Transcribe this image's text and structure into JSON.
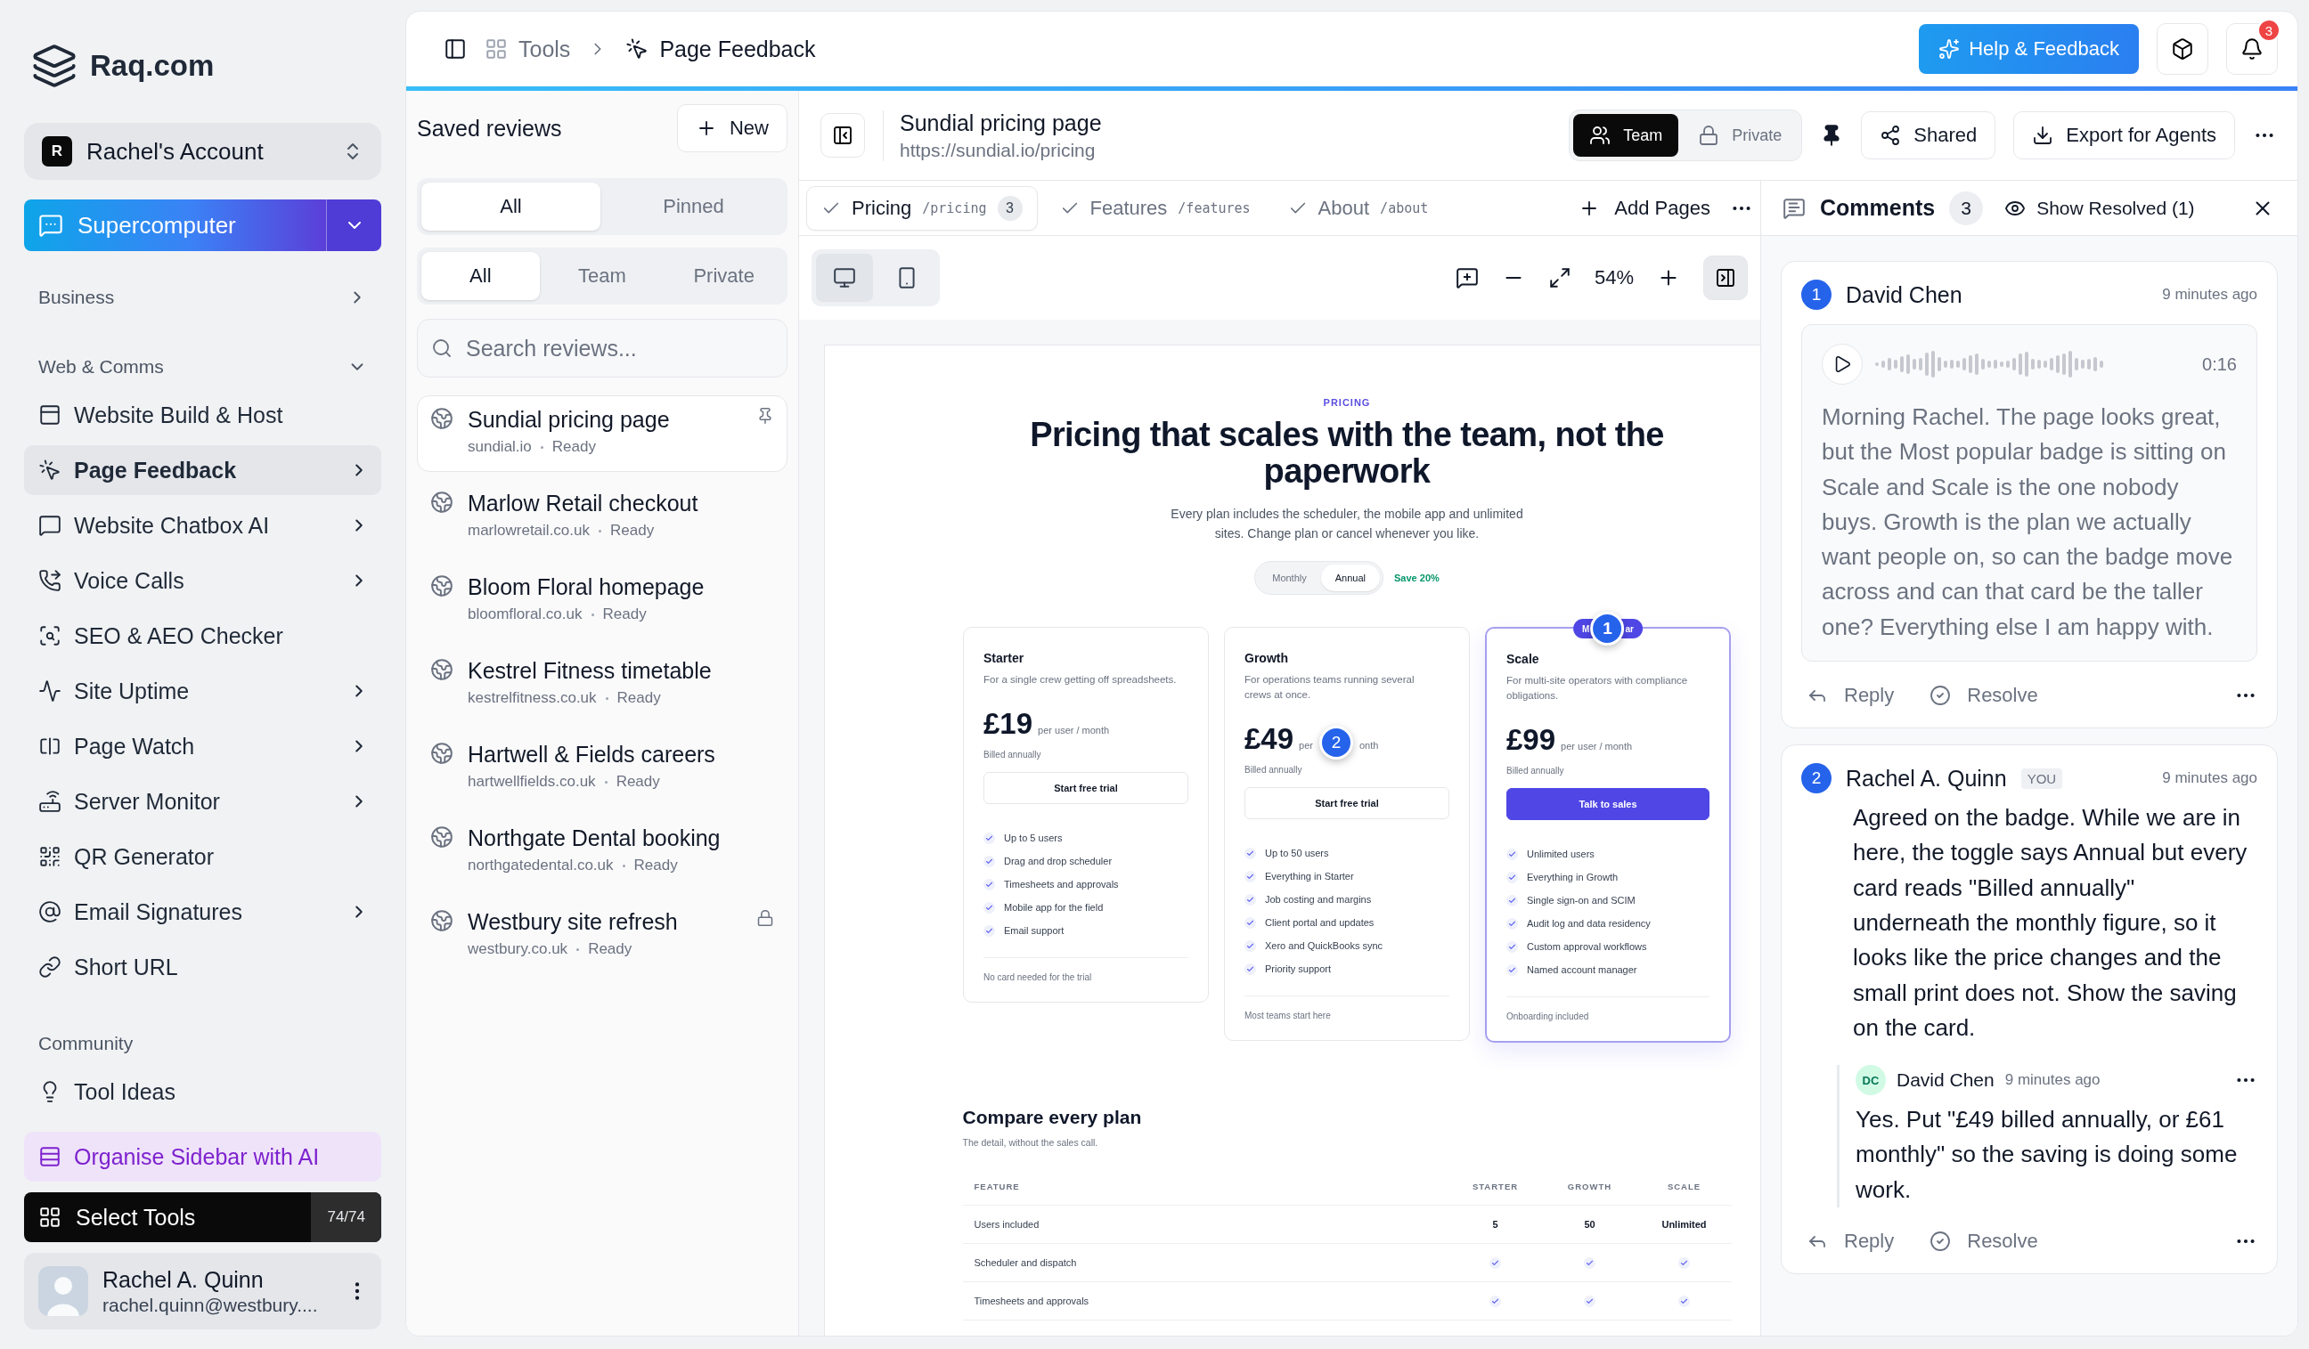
{
  "sidebar": {
    "brand": "Raq.com",
    "account": {
      "initial": "R",
      "name": "Rachel's Account"
    },
    "assistant": "Supercomputer",
    "sections": [
      {
        "title": "Business",
        "expanded": false
      },
      {
        "title": "Web & Comms",
        "expanded": true,
        "items": [
          {
            "label": "Website Build & Host",
            "selected": false,
            "submenu": false
          },
          {
            "label": "Page Feedback",
            "selected": true,
            "submenu": true
          },
          {
            "label": "Website Chatbox AI",
            "selected": false,
            "submenu": true
          },
          {
            "label": "Voice Calls",
            "selected": false,
            "submenu": true
          },
          {
            "label": "SEO & AEO Checker",
            "selected": false,
            "submenu": false
          },
          {
            "label": "Site Uptime",
            "selected": false,
            "submenu": true
          },
          {
            "label": "Page Watch",
            "selected": false,
            "submenu": true
          },
          {
            "label": "Server Monitor",
            "selected": false,
            "submenu": true
          },
          {
            "label": "QR Generator",
            "selected": false,
            "submenu": false
          },
          {
            "label": "Email Signatures",
            "selected": false,
            "submenu": true
          },
          {
            "label": "Short URL",
            "selected": false,
            "submenu": false
          }
        ]
      },
      {
        "title": "Community",
        "items": [
          {
            "label": "Tool Ideas",
            "selected": false,
            "submenu": false
          }
        ]
      }
    ],
    "organise": "Organise Sidebar with AI",
    "select_tools": {
      "label": "Select Tools",
      "count": "74/74"
    },
    "user": {
      "name": "Rachel A. Quinn",
      "email": "rachel.quinn@westbury...."
    }
  },
  "header": {
    "breadcrumb": [
      "Tools",
      "Page Feedback"
    ],
    "help_button": "Help & Feedback",
    "notification_count": "3"
  },
  "reviews": {
    "title": "Saved reviews",
    "new_button": "New",
    "scope_filter": [
      {
        "label": "All",
        "selected": true
      },
      {
        "label": "Pinned",
        "selected": false
      }
    ],
    "visibility_filter": [
      {
        "label": "All",
        "selected": true
      },
      {
        "label": "Team",
        "selected": false
      },
      {
        "label": "Private",
        "selected": false
      }
    ],
    "search_placeholder": "Search reviews...",
    "items": [
      {
        "title": "Sundial pricing page",
        "domain": "sundial.io",
        "status": "Ready",
        "selected": true,
        "pinned": true,
        "private": false
      },
      {
        "title": "Marlow Retail checkout",
        "domain": "marlowretail.co.uk",
        "status": "Ready",
        "selected": false,
        "pinned": false,
        "private": false
      },
      {
        "title": "Bloom Floral homepage",
        "domain": "bloomfloral.co.uk",
        "status": "Ready",
        "selected": false,
        "pinned": false,
        "private": false
      },
      {
        "title": "Kestrel Fitness timetable",
        "domain": "kestrelfitness.co.uk",
        "status": "Ready",
        "selected": false,
        "pinned": false,
        "private": false
      },
      {
        "title": "Hartwell & Fields careers",
        "domain": "hartwellfields.co.uk",
        "status": "Ready",
        "selected": false,
        "pinned": false,
        "private": false
      },
      {
        "title": "Northgate Dental booking",
        "domain": "northgatedental.co.uk",
        "status": "Ready",
        "selected": false,
        "pinned": false,
        "private": false
      },
      {
        "title": "Westbury site refresh",
        "domain": "westbury.co.uk",
        "status": "Ready",
        "selected": false,
        "pinned": false,
        "private": true
      }
    ]
  },
  "review": {
    "title": "Sundial pricing page",
    "url": "https://sundial.io/pricing",
    "visibility": [
      {
        "label": "Team",
        "selected": true
      },
      {
        "label": "Private",
        "selected": false
      }
    ],
    "pinned": true,
    "shared_button": "Shared",
    "export_button": "Export for Agents"
  },
  "pages": [
    {
      "label": "Pricing",
      "path": "/pricing",
      "count": "3",
      "selected": true
    },
    {
      "label": "Features",
      "path": "/features",
      "selected": false
    },
    {
      "label": "About",
      "path": "/about",
      "selected": false
    }
  ],
  "add_pages": "Add Pages",
  "toolbar": {
    "devices": [
      {
        "kind": "desktop",
        "selected": true
      },
      {
        "kind": "mobile",
        "selected": false
      }
    ],
    "zoom": "54%",
    "panel_open": true
  },
  "preview": {
    "eyebrow": "PRICING",
    "title": "Pricing that scales with the team, not the paperwork",
    "subtitle": "Every plan includes the scheduler, the mobile app and unlimited sites. Change plan or cancel whenever you like.",
    "billing_toggle": [
      {
        "label": "Monthly",
        "selected": false
      },
      {
        "label": "Annual",
        "selected": true
      }
    ],
    "saving": "Save 20%",
    "plans": [
      {
        "name": "Starter",
        "description": "For a single crew getting off spreadsheets.",
        "price": "£19",
        "unit": [
          "per user / month"
        ],
        "billing": "Billed annually",
        "cta": "Start free trial",
        "featured": false,
        "features": [
          "Up to 5 users",
          "Drag and drop scheduler",
          "Timesheets and approvals",
          "Mobile app for the field",
          "Email support"
        ],
        "footnote": "No card needed for the trial"
      },
      {
        "name": "Growth",
        "description": "For operations teams running several crews at once.",
        "price": "£49",
        "unit": [
          "per",
          "onth"
        ],
        "marker": "2",
        "billing": "Billed annually",
        "cta": "Start free trial",
        "featured": false,
        "features": [
          "Up to 50 users",
          "Everything in Starter",
          "Job costing and margins",
          "Client portal and updates",
          "Xero and QuickBooks sync",
          "Priority support"
        ],
        "footnote": "Most teams start here"
      },
      {
        "name": "Scale",
        "description": "For multi-site operators with compliance obligations.",
        "price": "£99",
        "unit": [
          "per user / month"
        ],
        "badge": [
          "M",
          "ar"
        ],
        "marker": "1",
        "billing": "Billed annually",
        "cta": "Talk to sales",
        "featured": true,
        "features": [
          "Unlimited users",
          "Everything in Growth",
          "Single sign-on and SCIM",
          "Audit log and data residency",
          "Custom approval workflows",
          "Named account manager"
        ],
        "footnote": "Onboarding included"
      }
    ],
    "compare": {
      "title": "Compare every plan",
      "subtitle": "The detail, without the sales call.",
      "columns": [
        "FEATURE",
        "STARTER",
        "GROWTH",
        "SCALE"
      ],
      "rows": [
        {
          "feature": "Users included",
          "kind": "text",
          "values": [
            "5",
            "50",
            "Unlimited"
          ]
        },
        {
          "feature": "Scheduler and dispatch",
          "kind": "check",
          "values": [
            true,
            true,
            true
          ]
        },
        {
          "feature": "Timesheets and approvals",
          "kind": "check",
          "values": [
            true,
            true,
            true
          ]
        }
      ]
    }
  },
  "comments": {
    "title": "Comments",
    "count": "3",
    "show_resolved": "Show Resolved (1)",
    "threads": [
      {
        "number": "1",
        "author": "David Chen",
        "time": "9 minutes ago",
        "kind": "voice",
        "duration": "0:16",
        "text": "Morning Rachel. The page looks great, but the Most popular badge is sitting on Scale and Scale is the one nobody buys. Growth is the plan we actually want people on, so can the badge move across and can that card be the taller one? Everything else I am happy with.",
        "actions": [
          "Reply",
          "Resolve"
        ]
      },
      {
        "number": "2",
        "author": "Rachel A. Quinn",
        "you": "YOU",
        "time": "9 minutes ago",
        "kind": "text",
        "text": "Agreed on the badge. While we are in here, the toggle says Annual but every card reads \"Billed annually\" underneath the monthly figure, so it looks like the price changes and the small print does not. Show the saving on the card.",
        "replies": [
          {
            "initials": "DC",
            "author": "David Chen",
            "time": "9 minutes ago",
            "text": "Yes. Put \"£49 billed annually, or £61 monthly\" so the saving is doing some work."
          }
        ],
        "actions": [
          "Reply",
          "Resolve"
        ]
      }
    ]
  }
}
